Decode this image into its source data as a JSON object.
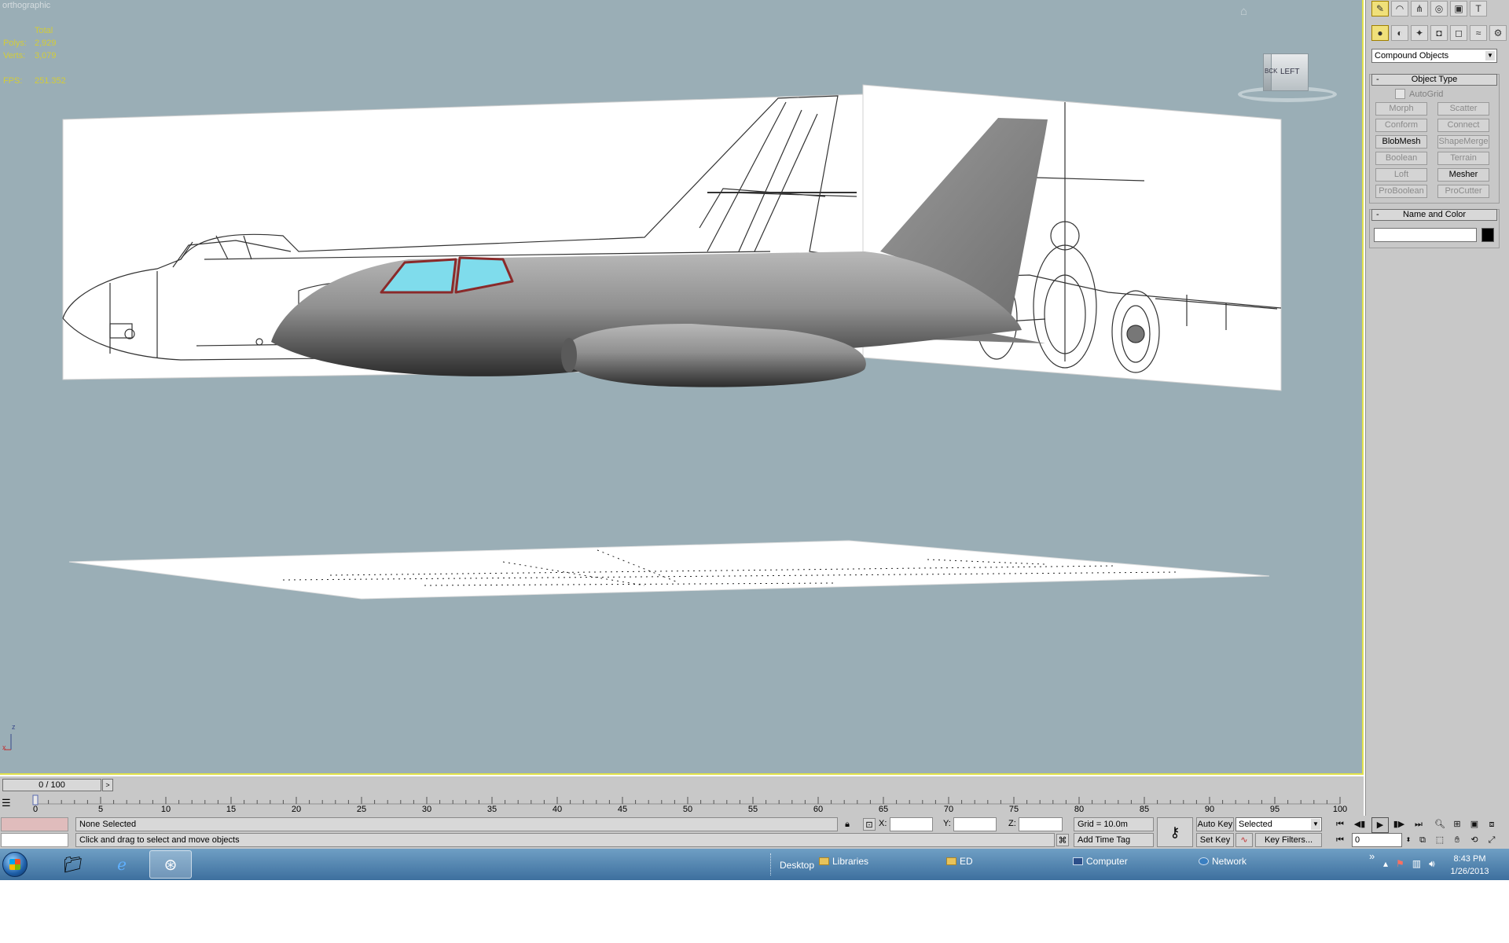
{
  "viewport": {
    "label": "orthographic",
    "stats": [
      {
        "key": "",
        "value": "Total"
      },
      {
        "key": "Polys:",
        "value": "2,929"
      },
      {
        "key": "Verts:",
        "value": "3,079"
      },
      {
        "key": "",
        "value": ""
      },
      {
        "key": "FPS:",
        "value": "251.352"
      }
    ],
    "viewcube": {
      "face_label": "LEFT",
      "side_label": "BCK"
    },
    "axis": {
      "z": "z",
      "x": "x"
    }
  },
  "command_panel": {
    "tabs": [
      "create-icon",
      "modify-icon",
      "hierarchy-icon",
      "motion-icon",
      "display-icon",
      "utilities-icon"
    ],
    "subtabs": [
      "geometry-icon",
      "shapes-icon",
      "lights-icon",
      "cameras-icon",
      "helpers-icon",
      "spacewarps-icon",
      "systems-icon"
    ],
    "category": "Compound Objects",
    "object_type": {
      "title": "Object Type",
      "autogrid_label": "AutoGrid",
      "buttons": [
        {
          "label": "Morph",
          "enabled": false
        },
        {
          "label": "Scatter",
          "enabled": false
        },
        {
          "label": "Conform",
          "enabled": false
        },
        {
          "label": "Connect",
          "enabled": false
        },
        {
          "label": "BlobMesh",
          "enabled": true
        },
        {
          "label": "ShapeMerge",
          "enabled": false
        },
        {
          "label": "Boolean",
          "enabled": false
        },
        {
          "label": "Terrain",
          "enabled": false
        },
        {
          "label": "Loft",
          "enabled": false
        },
        {
          "label": "Mesher",
          "enabled": true
        },
        {
          "label": "ProBoolean",
          "enabled": false
        },
        {
          "label": "ProCutter",
          "enabled": false
        }
      ]
    },
    "name_and_color": {
      "title": "Name and Color",
      "name_value": "",
      "color": "#000000"
    },
    "collapse_symbol": "-"
  },
  "timeline": {
    "slider_label": "0 / 100",
    "next_symbol": ">",
    "ticks": [
      "0",
      "5",
      "10",
      "15",
      "20",
      "25",
      "30",
      "35",
      "40",
      "45",
      "50",
      "55",
      "60",
      "65",
      "70",
      "75",
      "80",
      "85",
      "90",
      "95",
      "100"
    ]
  },
  "status": {
    "selection": "None Selected",
    "prompt": "Click and drag to select and move objects",
    "x_label": "X:",
    "y_label": "Y:",
    "z_label": "Z:",
    "x_value": "",
    "y_value": "",
    "z_value": "",
    "grid": "Grid = 10.0m",
    "add_time_tag": "Add Time Tag",
    "auto_key": "Auto Key",
    "set_key": "Set Key",
    "key_select": "Selected",
    "key_filters": "Key Filters...",
    "frame": "0"
  },
  "taskbar": {
    "toolbar_label": "Desktop",
    "items": [
      "Libraries",
      "ED",
      "Computer",
      "Network"
    ],
    "chevron": "»",
    "time": "8:43 PM",
    "date": "1/26/2013"
  },
  "colors": {
    "viewport_bg": "#9aaeb6",
    "viewport_border": "#e2e24a",
    "stats_text": "#d2cc3a",
    "model_gray": "#8f8f8f",
    "canopy": "#7fdcec",
    "canopy_frame": "#8a2a2a"
  }
}
